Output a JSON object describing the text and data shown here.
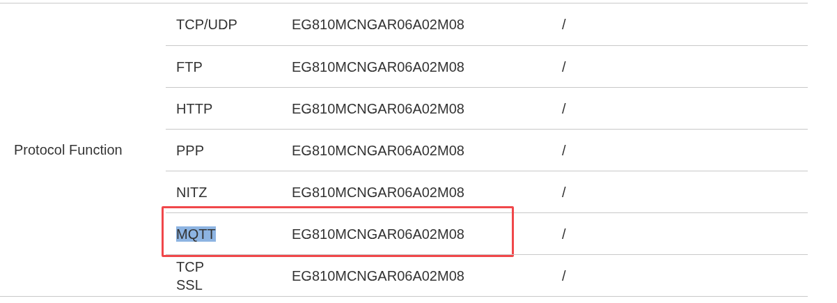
{
  "table": {
    "group_label": "Protocol Function",
    "rows": [
      {
        "feature": "TCP/UDP",
        "version": "EG810MCNGAR06A02M08",
        "note": "/",
        "text_selected": false,
        "annotated": false
      },
      {
        "feature": "FTP",
        "version": "EG810MCNGAR06A02M08",
        "note": "/",
        "text_selected": false,
        "annotated": false
      },
      {
        "feature": "HTTP",
        "version": "EG810MCNGAR06A02M08",
        "note": "/",
        "text_selected": false,
        "annotated": false
      },
      {
        "feature": "PPP",
        "version": "EG810MCNGAR06A02M08",
        "note": "/",
        "text_selected": false,
        "annotated": false
      },
      {
        "feature": "NITZ",
        "version": "EG810MCNGAR06A02M08",
        "note": "/",
        "text_selected": false,
        "annotated": false
      },
      {
        "feature": "MQTT",
        "version": "EG810MCNGAR06A02M08",
        "note": "/",
        "text_selected": true,
        "annotated": true
      },
      {
        "feature": "TCP\nSSL",
        "version": "EG810MCNGAR06A02M08",
        "note": "/",
        "text_selected": false,
        "annotated": false
      }
    ]
  }
}
